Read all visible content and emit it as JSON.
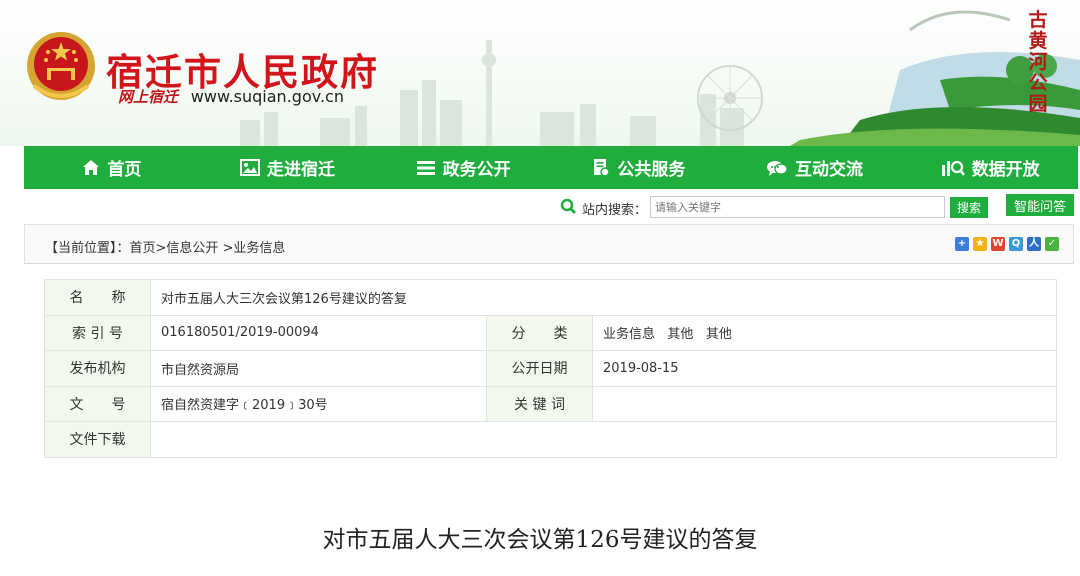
{
  "header": {
    "site_name": "宿迁市人民政府",
    "slogan": "网上宿迁",
    "url": "www.suqian.gov.cn",
    "calligraphy": "古黄河公园"
  },
  "nav": {
    "items": [
      {
        "label": "首页",
        "icon": "home-icon"
      },
      {
        "label": "走进宿迁",
        "icon": "image-icon"
      },
      {
        "label": "政务公开",
        "icon": "list-icon"
      },
      {
        "label": "公共服务",
        "icon": "document-icon"
      },
      {
        "label": "互动交流",
        "icon": "chat-icon"
      },
      {
        "label": "数据开放",
        "icon": "data-search-icon"
      }
    ]
  },
  "search": {
    "label": "站内搜索：",
    "placeholder": "请输入关键字",
    "button": "搜索",
    "ai_button": "智能问答"
  },
  "breadcrumb": {
    "text": "【当前位置】：首页>信息公开 >业务信息"
  },
  "share_icons": [
    "add-share-icon",
    "qzone-share-icon",
    "weibo-share-icon",
    "tencent-share-icon",
    "renren-share-icon",
    "wechat-share-icon"
  ],
  "info": {
    "name_label": "名　　称",
    "name_value": "对市五届人大三次会议第126号建议的答复",
    "index_label": "索 引 号",
    "index_value": "016180501/2019-00094",
    "category_label": "分　　类",
    "category_values": [
      "业务信息",
      "其他",
      "其他"
    ],
    "publisher_label": "发布机构",
    "publisher_value": "市自然资源局",
    "date_label": "公开日期",
    "date_value": "2019-08-15",
    "docno_label": "文　　号",
    "docno_value": "宿自然资建字﹝2019﹞30号",
    "keywords_label": "关 键 词",
    "keywords_value": "",
    "download_label": "文件下载",
    "download_value": ""
  },
  "document": {
    "title": "对市五届人大三次会议第126号建议的答复"
  },
  "colors": {
    "brand_red": "#d2141b",
    "nav_green": "#1fae3d",
    "label_bg": "#f2f8ee"
  }
}
